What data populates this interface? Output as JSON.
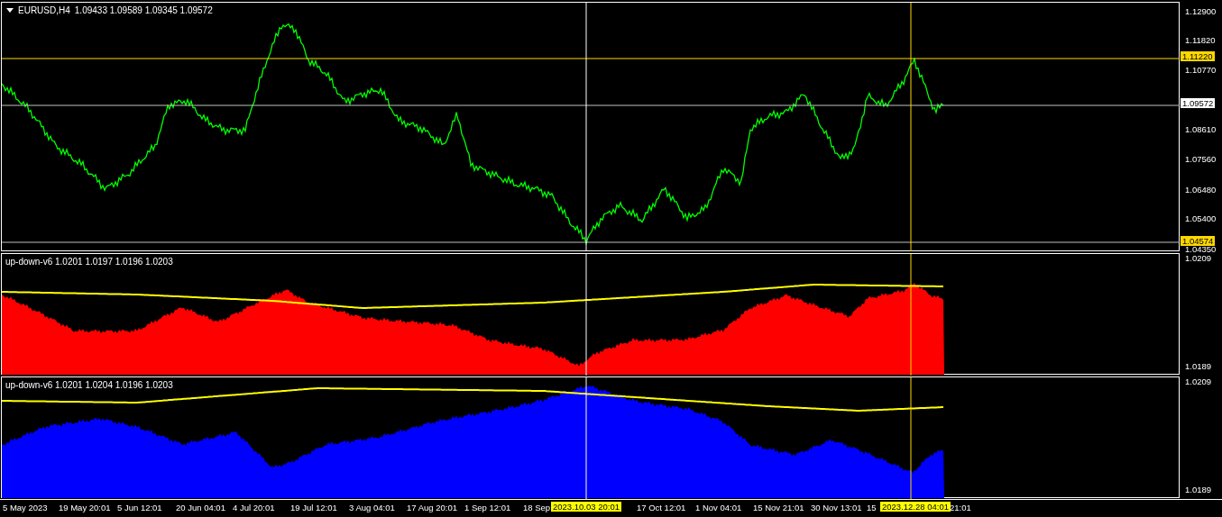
{
  "chart_header": {
    "title": "EURUSD,H4",
    "ohlc": "1.09433 1.09589 1.09345 1.09572"
  },
  "price_axis": {
    "ticks": [
      "1.12900",
      "1.11820",
      "1.10770",
      "1.08610",
      "1.07560",
      "1.06480",
      "1.05400",
      "1.04350"
    ],
    "current_price": "1.09572",
    "crosshair_labels": [
      "1.11220",
      "1.04574"
    ]
  },
  "indicators": [
    {
      "label": "up-down-v6 1.0201 1.0197 1.0196 1.0203",
      "color": "#ff0000",
      "axis_ticks": [
        "1.0209",
        "1.0189"
      ]
    },
    {
      "label": "up-down-v6 1.0201 1.0204 1.0196 1.0203",
      "color": "#0000ff",
      "axis_ticks": [
        "1.0209",
        "1.0189"
      ]
    }
  ],
  "time_axis": {
    "ticks": [
      "5 May 2023",
      "19 May 20:01",
      "5 Jun 12:01",
      "20 Jun 04:01",
      "4 Jul 20:01",
      "19 Jul 12:01",
      "3 Aug 04:01",
      "17 Aug 20:01",
      "1 Sep 12:01",
      "18 Sep",
      "17 Oct 12:01",
      "1 Nov 04:01",
      "15 Nov 21:01",
      "30 Nov 13:01",
      "15",
      "21:01"
    ],
    "crosshair_labels": [
      "2023.10.03 20:01",
      "2023.12.28 04:01"
    ]
  }
}
